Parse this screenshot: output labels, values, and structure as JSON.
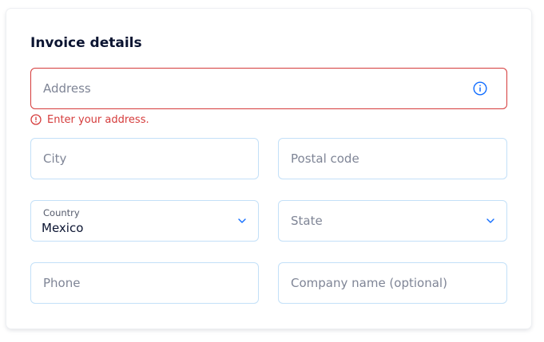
{
  "form": {
    "title": "Invoice details",
    "address": {
      "placeholder": "Address",
      "info_icon": "info-icon",
      "error": "Enter your address."
    },
    "city": {
      "placeholder": "City"
    },
    "postal_code": {
      "placeholder": "Postal code"
    },
    "country": {
      "label": "Country",
      "value": "Mexico"
    },
    "state": {
      "placeholder": "State"
    },
    "phone": {
      "placeholder": "Phone"
    },
    "company": {
      "placeholder": "Company name (optional)"
    }
  },
  "colors": {
    "border": "#c3e0f8",
    "error": "#d53b3b",
    "accent": "#116dff",
    "text": "#0b1431",
    "placeholder": "#7f8596"
  }
}
